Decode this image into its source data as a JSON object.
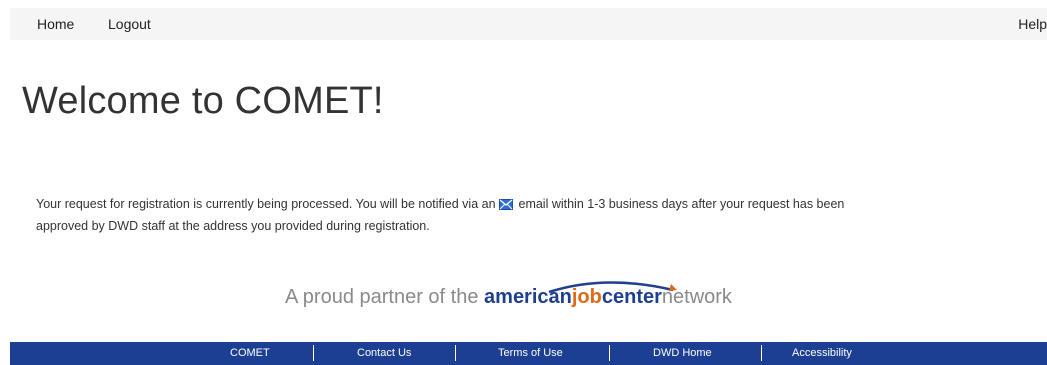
{
  "nav": {
    "home_label": "Home",
    "logout_label": "Logout",
    "help_label": "Help"
  },
  "main": {
    "title": "Welcome to COMET!",
    "message_part1": "Your request for registration is currently being processed. You will be notified via an ",
    "message_part2": " email within 1-3 business days after your request has been approved by DWD staff at the address you provided during registration.",
    "mail_icon": "mail-icon"
  },
  "partner": {
    "prefix": "A proud partner of the ",
    "american": "american",
    "job": "job",
    "center": "center",
    "network": "network"
  },
  "footer": {
    "links": [
      "COMET",
      "Contact Us",
      "Terms of Use",
      "DWD Home",
      "Accessibility"
    ]
  },
  "colors": {
    "footer_bg": "#1c3f93",
    "brand_blue": "#1f3f8f",
    "brand_orange": "#e06a1a",
    "mail_icon_blue": "#2d6fd6"
  }
}
